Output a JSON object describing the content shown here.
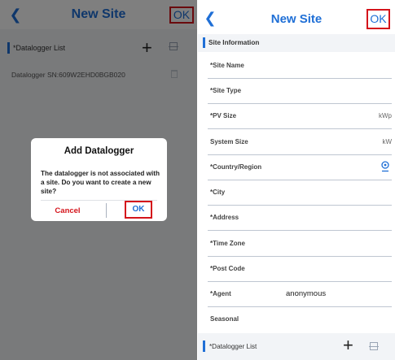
{
  "left_screen": {
    "header": {
      "back_icon": "chevron-left-icon",
      "title": "New Site",
      "ok_label": "OK"
    },
    "datalogger_section": {
      "label": "*Datalogger List",
      "add_icon": "plus-icon",
      "scan_icon": "scan-icon"
    },
    "datalogger_row": {
      "text": "Datalogger SN:609W2EHD0BGB020",
      "delete_icon": "trash-icon"
    },
    "dialog": {
      "title": "Add Datalogger",
      "message": "The datalogger is not associated with a site. Do you want to create a new site?",
      "cancel_label": "Cancel",
      "ok_label": "OK"
    }
  },
  "right_screen": {
    "header": {
      "back_icon": "chevron-left-icon",
      "title": "New Site",
      "ok_label": "OK"
    },
    "section": {
      "label": "Site Information"
    },
    "fields": [
      {
        "label": "*Site Name",
        "unit": "",
        "value": ""
      },
      {
        "label": "*Site Type",
        "unit": "",
        "value": ""
      },
      {
        "label": "*PV Size",
        "unit": "kWp",
        "value": ""
      },
      {
        "label": "System Size",
        "unit": "kW",
        "value": ""
      },
      {
        "label": "*Country/Region",
        "unit": "",
        "value": "",
        "icon": "location-pin-icon"
      },
      {
        "label": "*City",
        "unit": "",
        "value": ""
      },
      {
        "label": "*Address",
        "unit": "",
        "value": ""
      },
      {
        "label": "*Time Zone",
        "unit": "",
        "value": ""
      },
      {
        "label": "*Post Code",
        "unit": "",
        "value": ""
      },
      {
        "label": "*Agent",
        "unit": "",
        "value": "anonymous"
      },
      {
        "label": "Seasonal",
        "unit": "",
        "value": ""
      }
    ],
    "footer": {
      "label": "*Datalogger List",
      "add_icon": "plus-icon",
      "scan_icon": "scan-icon"
    }
  },
  "colors": {
    "accent": "#1f6fd6",
    "highlight": "#d4141b",
    "cancel": "#d4141b",
    "section_bg": "#f2f4f7"
  }
}
